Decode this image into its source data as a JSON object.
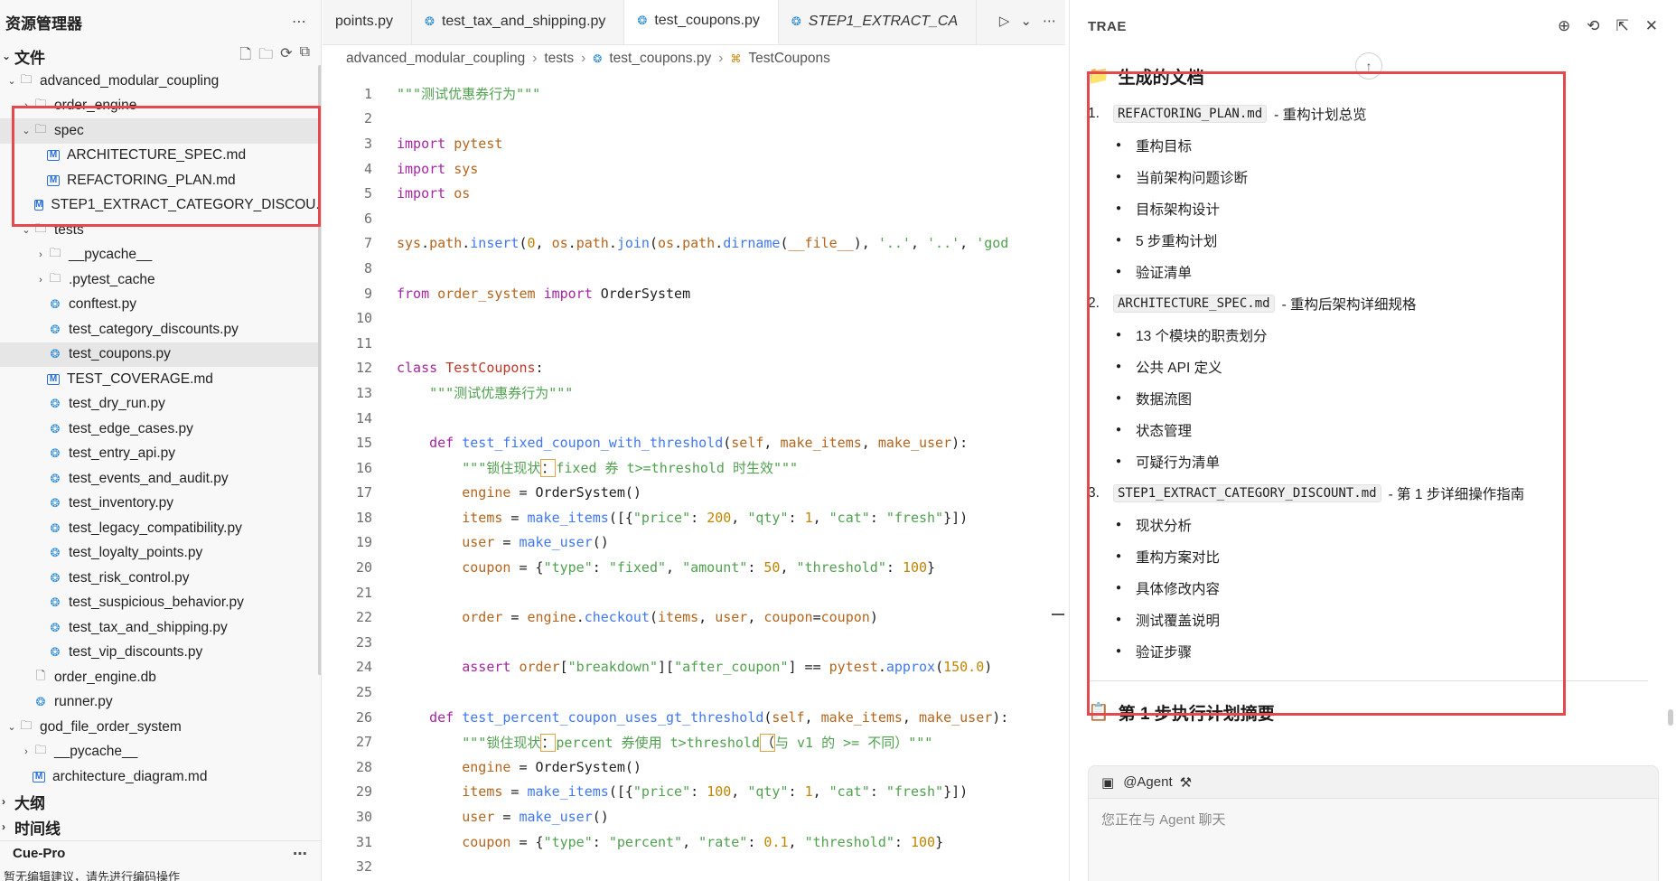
{
  "explorer": {
    "title": "资源管理器",
    "files_section": "文件",
    "outline_section": "大纲",
    "timeline_section": "时间线",
    "tree": [
      {
        "label": "advanced_modular_coupling",
        "depth": 0,
        "type": "folder",
        "expanded": true
      },
      {
        "label": "order_engine",
        "depth": 1,
        "type": "folder",
        "expanded": false
      },
      {
        "label": "spec",
        "depth": 1,
        "type": "folder",
        "expanded": true,
        "selected": true
      },
      {
        "label": "ARCHITECTURE_SPEC.md",
        "depth": 2,
        "type": "md"
      },
      {
        "label": "REFACTORING_PLAN.md",
        "depth": 2,
        "type": "md"
      },
      {
        "label": "STEP1_EXTRACT_CATEGORY_DISCOU...",
        "depth": 2,
        "type": "md"
      },
      {
        "label": "tests",
        "depth": 1,
        "type": "folder",
        "expanded": true
      },
      {
        "label": "__pycache__",
        "depth": 2,
        "type": "folder",
        "expanded": false
      },
      {
        "label": ".pytest_cache",
        "depth": 2,
        "type": "folder",
        "expanded": false
      },
      {
        "label": "conftest.py",
        "depth": 2,
        "type": "py"
      },
      {
        "label": "test_category_discounts.py",
        "depth": 2,
        "type": "py"
      },
      {
        "label": "test_coupons.py",
        "depth": 2,
        "type": "py",
        "selected": true
      },
      {
        "label": "TEST_COVERAGE.md",
        "depth": 2,
        "type": "md"
      },
      {
        "label": "test_dry_run.py",
        "depth": 2,
        "type": "py"
      },
      {
        "label": "test_edge_cases.py",
        "depth": 2,
        "type": "py"
      },
      {
        "label": "test_entry_api.py",
        "depth": 2,
        "type": "py"
      },
      {
        "label": "test_events_and_audit.py",
        "depth": 2,
        "type": "py"
      },
      {
        "label": "test_inventory.py",
        "depth": 2,
        "type": "py"
      },
      {
        "label": "test_legacy_compatibility.py",
        "depth": 2,
        "type": "py"
      },
      {
        "label": "test_loyalty_points.py",
        "depth": 2,
        "type": "py"
      },
      {
        "label": "test_risk_control.py",
        "depth": 2,
        "type": "py"
      },
      {
        "label": "test_suspicious_behavior.py",
        "depth": 2,
        "type": "py"
      },
      {
        "label": "test_tax_and_shipping.py",
        "depth": 2,
        "type": "py"
      },
      {
        "label": "test_vip_discounts.py",
        "depth": 2,
        "type": "py"
      },
      {
        "label": "order_engine.db",
        "depth": 1,
        "type": "file"
      },
      {
        "label": "runner.py",
        "depth": 1,
        "type": "py"
      },
      {
        "label": "god_file_order_system",
        "depth": 0,
        "type": "folder",
        "expanded": true
      },
      {
        "label": "__pycache__",
        "depth": 1,
        "type": "folder",
        "expanded": false
      },
      {
        "label": "architecture_diagram.md",
        "depth": 1,
        "type": "md"
      }
    ],
    "cue_title": "Cue-Pro",
    "cue_note": "暂无编辑建议，请先进行编码操作"
  },
  "editor": {
    "tabs": [
      {
        "label": "points.py",
        "active": false,
        "italic": false,
        "icon": false
      },
      {
        "label": "test_tax_and_shipping.py",
        "active": false,
        "italic": false,
        "icon": true
      },
      {
        "label": "test_coupons.py",
        "active": true,
        "italic": false,
        "icon": true
      },
      {
        "label": "STEP1_EXTRACT_CA",
        "active": false,
        "italic": true,
        "icon": true
      }
    ],
    "breadcrumbs": [
      "advanced_modular_coupling",
      "tests",
      "test_coupons.py",
      "TestCoupons"
    ],
    "lines": [
      [
        [
          "doc",
          "\"\"\"测试优惠券行为\"\"\""
        ]
      ],
      [],
      [
        [
          "kw",
          "import"
        ],
        [
          "t",
          " "
        ],
        [
          "mod",
          "pytest"
        ]
      ],
      [
        [
          "kw",
          "import"
        ],
        [
          "t",
          " "
        ],
        [
          "mod",
          "sys"
        ]
      ],
      [
        [
          "kw",
          "import"
        ],
        [
          "t",
          " "
        ],
        [
          "mod",
          "os"
        ]
      ],
      [],
      [
        [
          "mod",
          "sys"
        ],
        [
          "t",
          "."
        ],
        [
          "mod",
          "path"
        ],
        [
          "t",
          "."
        ],
        [
          "fn",
          "insert"
        ],
        [
          "t",
          "("
        ],
        [
          "num",
          "0"
        ],
        [
          "t",
          ", "
        ],
        [
          "mod",
          "os"
        ],
        [
          "t",
          "."
        ],
        [
          "mod",
          "path"
        ],
        [
          "t",
          "."
        ],
        [
          "fn",
          "join"
        ],
        [
          "t",
          "("
        ],
        [
          "mod",
          "os"
        ],
        [
          "t",
          "."
        ],
        [
          "mod",
          "path"
        ],
        [
          "t",
          "."
        ],
        [
          "fn",
          "dirname"
        ],
        [
          "t",
          "("
        ],
        [
          "mod",
          "__file__"
        ],
        [
          "t",
          "), "
        ],
        [
          "str",
          "'..'"
        ],
        [
          "t",
          ", "
        ],
        [
          "str",
          "'..'"
        ],
        [
          "t",
          ", "
        ],
        [
          "str",
          "'god"
        ]
      ],
      [],
      [
        [
          "kw",
          "from"
        ],
        [
          "t",
          " "
        ],
        [
          "mod",
          "order_system"
        ],
        [
          "t",
          " "
        ],
        [
          "kw",
          "import"
        ],
        [
          "t",
          " OrderSystem"
        ]
      ],
      [],
      [],
      [
        [
          "kw",
          "class"
        ],
        [
          "t",
          " "
        ],
        [
          "ident",
          "TestCoupons"
        ],
        [
          "t",
          ":"
        ]
      ],
      [
        [
          "t",
          "    "
        ],
        [
          "doc",
          "\"\"\"测试优惠券行为\"\"\""
        ]
      ],
      [],
      [
        [
          "t",
          "    "
        ],
        [
          "kw",
          "def"
        ],
        [
          "t",
          " "
        ],
        [
          "fn",
          "test_fixed_coupon_with_threshold"
        ],
        [
          "t",
          "("
        ],
        [
          "mod",
          "self"
        ],
        [
          "t",
          ", "
        ],
        [
          "mod",
          "make_items"
        ],
        [
          "t",
          ", "
        ],
        [
          "mod",
          "make_user"
        ],
        [
          "t",
          "):"
        ]
      ],
      [
        [
          "t",
          "        "
        ],
        [
          "doc",
          "\"\"\"锁住现状"
        ],
        [
          "mark",
          "："
        ],
        [
          "doc",
          "fixed 券 t>=threshold 时生效\"\"\""
        ]
      ],
      [
        [
          "t",
          "        "
        ],
        [
          "mod",
          "engine"
        ],
        [
          "t",
          " = OrderSystem()"
        ]
      ],
      [
        [
          "t",
          "        "
        ],
        [
          "mod",
          "items"
        ],
        [
          "t",
          " = "
        ],
        [
          "fn",
          "make_items"
        ],
        [
          "t",
          "([{"
        ],
        [
          "str",
          "\"price\""
        ],
        [
          "t",
          ": "
        ],
        [
          "num",
          "200"
        ],
        [
          "t",
          ", "
        ],
        [
          "str",
          "\"qty\""
        ],
        [
          "t",
          ": "
        ],
        [
          "num",
          "1"
        ],
        [
          "t",
          ", "
        ],
        [
          "str",
          "\"cat\""
        ],
        [
          "t",
          ": "
        ],
        [
          "str",
          "\"fresh\""
        ],
        [
          "t",
          "}])"
        ]
      ],
      [
        [
          "t",
          "        "
        ],
        [
          "mod",
          "user"
        ],
        [
          "t",
          " = "
        ],
        [
          "fn",
          "make_user"
        ],
        [
          "t",
          "()"
        ]
      ],
      [
        [
          "t",
          "        "
        ],
        [
          "mod",
          "coupon"
        ],
        [
          "t",
          " = {"
        ],
        [
          "str",
          "\"type\""
        ],
        [
          "t",
          ": "
        ],
        [
          "str",
          "\"fixed\""
        ],
        [
          "t",
          ", "
        ],
        [
          "str",
          "\"amount\""
        ],
        [
          "t",
          ": "
        ],
        [
          "num",
          "50"
        ],
        [
          "t",
          ", "
        ],
        [
          "str",
          "\"threshold\""
        ],
        [
          "t",
          ": "
        ],
        [
          "num",
          "100"
        ],
        [
          "t",
          "}"
        ]
      ],
      [],
      [
        [
          "t",
          "        "
        ],
        [
          "mod",
          "order"
        ],
        [
          "t",
          " = "
        ],
        [
          "mod",
          "engine"
        ],
        [
          "t",
          "."
        ],
        [
          "fn",
          "checkout"
        ],
        [
          "t",
          "("
        ],
        [
          "mod",
          "items"
        ],
        [
          "t",
          ", "
        ],
        [
          "mod",
          "user"
        ],
        [
          "t",
          ", "
        ],
        [
          "mod",
          "coupon"
        ],
        [
          "t",
          "="
        ],
        [
          "mod",
          "coupon"
        ],
        [
          "t",
          ")"
        ]
      ],
      [],
      [
        [
          "t",
          "        "
        ],
        [
          "kw",
          "assert"
        ],
        [
          "t",
          " "
        ],
        [
          "mod",
          "order"
        ],
        [
          "t",
          "["
        ],
        [
          "str",
          "\"breakdown\""
        ],
        [
          "t",
          "]["
        ],
        [
          "str",
          "\"after_coupon\""
        ],
        [
          "t",
          "] == "
        ],
        [
          "mod",
          "pytest"
        ],
        [
          "t",
          "."
        ],
        [
          "fn",
          "approx"
        ],
        [
          "t",
          "("
        ],
        [
          "num",
          "150.0"
        ],
        [
          "t",
          ")"
        ]
      ],
      [],
      [
        [
          "t",
          "    "
        ],
        [
          "kw",
          "def"
        ],
        [
          "t",
          " "
        ],
        [
          "fn",
          "test_percent_coupon_uses_gt_threshold"
        ],
        [
          "t",
          "("
        ],
        [
          "mod",
          "self"
        ],
        [
          "t",
          ", "
        ],
        [
          "mod",
          "make_items"
        ],
        [
          "t",
          ", "
        ],
        [
          "mod",
          "make_user"
        ],
        [
          "t",
          "):"
        ]
      ],
      [
        [
          "t",
          "        "
        ],
        [
          "doc",
          "\"\"\"锁住现状"
        ],
        [
          "mark",
          "："
        ],
        [
          "doc",
          "percent 券使用 t>threshold"
        ],
        [
          "mark",
          "（"
        ],
        [
          "doc",
          "与 v1 的 >= 不同）\"\"\""
        ]
      ],
      [
        [
          "t",
          "        "
        ],
        [
          "mod",
          "engine"
        ],
        [
          "t",
          " = OrderSystem()"
        ]
      ],
      [
        [
          "t",
          "        "
        ],
        [
          "mod",
          "items"
        ],
        [
          "t",
          " = "
        ],
        [
          "fn",
          "make_items"
        ],
        [
          "t",
          "([{"
        ],
        [
          "str",
          "\"price\""
        ],
        [
          "t",
          ": "
        ],
        [
          "num",
          "100"
        ],
        [
          "t",
          ", "
        ],
        [
          "str",
          "\"qty\""
        ],
        [
          "t",
          ": "
        ],
        [
          "num",
          "1"
        ],
        [
          "t",
          ", "
        ],
        [
          "str",
          "\"cat\""
        ],
        [
          "t",
          ": "
        ],
        [
          "str",
          "\"fresh\""
        ],
        [
          "t",
          "}])"
        ]
      ],
      [
        [
          "t",
          "        "
        ],
        [
          "mod",
          "user"
        ],
        [
          "t",
          " = "
        ],
        [
          "fn",
          "make_user"
        ],
        [
          "t",
          "()"
        ]
      ],
      [
        [
          "t",
          "        "
        ],
        [
          "mod",
          "coupon"
        ],
        [
          "t",
          " = {"
        ],
        [
          "str",
          "\"type\""
        ],
        [
          "t",
          ": "
        ],
        [
          "str",
          "\"percent\""
        ],
        [
          "t",
          ", "
        ],
        [
          "str",
          "\"rate\""
        ],
        [
          "t",
          ": "
        ],
        [
          "num",
          "0.1"
        ],
        [
          "t",
          ", "
        ],
        [
          "str",
          "\"threshold\""
        ],
        [
          "t",
          ": "
        ],
        [
          "num",
          "100"
        ],
        [
          "t",
          "}"
        ]
      ],
      []
    ]
  },
  "ai": {
    "title": "TRAE",
    "section1": "生成的文档",
    "docs": [
      {
        "num": "1.",
        "file": "REFACTORING_PLAN.md",
        "desc": "- 重构计划总览",
        "bullets": [
          "重构目标",
          "当前架构问题诊断",
          "目标架构设计",
          "5 步重构计划",
          "验证清单"
        ]
      },
      {
        "num": "2.",
        "file": "ARCHITECTURE_SPEC.md",
        "desc": "- 重构后架构详细规格",
        "bullets": [
          "13 个模块的职责划分",
          "公共 API 定义",
          "数据流图",
          "状态管理",
          "可疑行为清单"
        ]
      },
      {
        "num": "3.",
        "file": "STEP1_EXTRACT_CATEGORY_DISCOUNT.md",
        "desc": "- 第 1 步详细操作指南",
        "bullets": [
          "现状分析",
          "重构方案对比",
          "具体修改内容",
          "测试覆盖说明",
          "验证步骤"
        ]
      }
    ],
    "section2": "第 1 步执行计划摘要",
    "chat_agent": "@Agent",
    "chat_placeholder": "您正在与 Agent 聊天"
  },
  "colors": {
    "highlight_box": "#e5484d",
    "python_icon": "#2b8bd6"
  }
}
